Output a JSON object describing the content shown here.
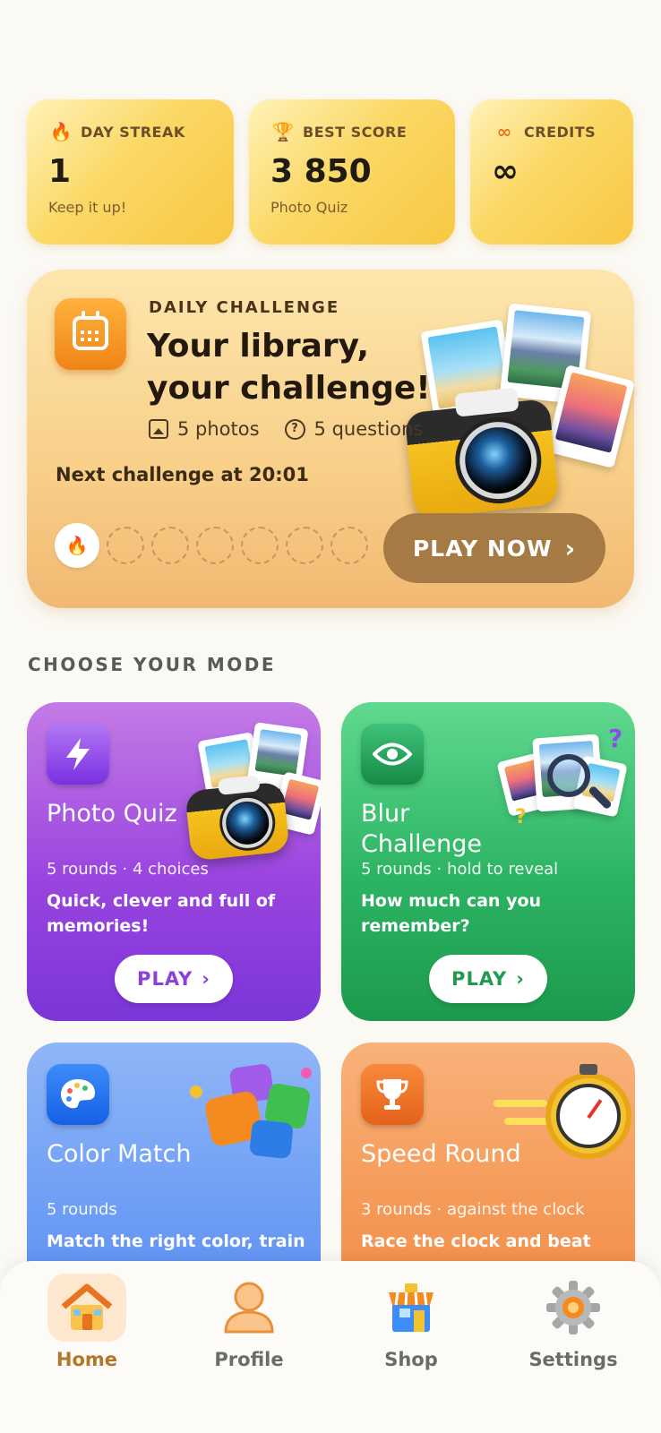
{
  "stats": [
    {
      "icon": "flame-icon",
      "label": "DAY STREAK",
      "value": "1",
      "sub": "Keep it up!"
    },
    {
      "icon": "trophy-icon",
      "label": "BEST SCORE",
      "value": "3 850",
      "sub": "Photo Quiz"
    },
    {
      "icon": "infinity-icon",
      "label": "CREDITS",
      "value": "∞",
      "sub": ""
    }
  ],
  "daily": {
    "kicker": "DAILY CHALLENGE",
    "title": "Your library, your challenge!",
    "photos": "5 photos",
    "questions": "5 questions",
    "next": "Next challenge at 20:01",
    "streak_total": 7,
    "streak_done": 1,
    "play_label": "PLAY NOW"
  },
  "section_title": "CHOOSE YOUR MODE",
  "modes": [
    {
      "title": "Photo Quiz",
      "rounds": "5 rounds · 4 choices",
      "desc": "Quick, clever and full of memories!",
      "play": "PLAY",
      "color": "#8b3fdc"
    },
    {
      "title": "Blur Challenge",
      "rounds": "5 rounds · hold to reveal",
      "desc": "How much can you remember?",
      "play": "PLAY",
      "color": "#1f9a4f"
    },
    {
      "title": "Color Match",
      "rounds": "5 rounds",
      "desc": "Match the right color, train",
      "play": "",
      "color": "#5a8ef3"
    },
    {
      "title": "Speed Round",
      "rounds": "3 rounds · against the clock",
      "desc": "Race the clock and beat",
      "play": "",
      "color": "#f28c45"
    }
  ],
  "nav": [
    {
      "label": "Home",
      "icon": "home-icon",
      "active": true
    },
    {
      "label": "Profile",
      "icon": "profile-icon",
      "active": false
    },
    {
      "label": "Shop",
      "icon": "shop-icon",
      "active": false
    },
    {
      "label": "Settings",
      "icon": "settings-icon",
      "active": false
    }
  ]
}
